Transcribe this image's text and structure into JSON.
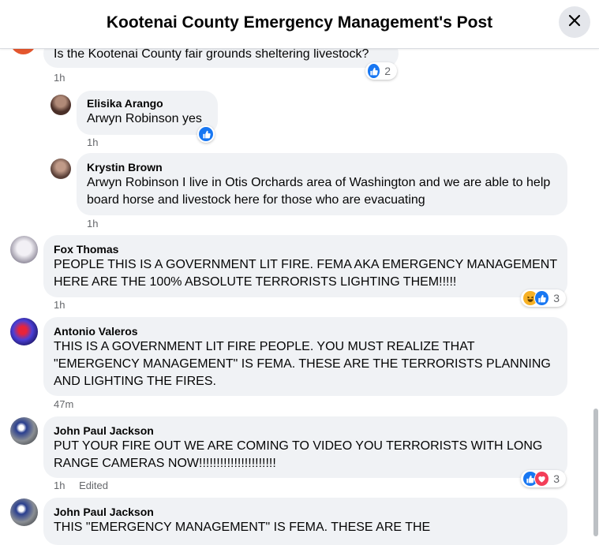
{
  "header": {
    "title": "Kootenai County Emergency Management's Post"
  },
  "comments": [
    {
      "text": "Is the Kootenai County fair grounds sheltering livestock?",
      "time": "1h",
      "reactions": {
        "types": [
          "like"
        ],
        "count": "2"
      }
    },
    {
      "author": "Elisika Arango",
      "text": "Arwyn Robinson yes",
      "time": "1h",
      "reactions": {
        "types": [
          "like"
        ],
        "count": ""
      }
    },
    {
      "author": "Krystin Brown",
      "text": "Arwyn Robinson I live in Otis Orchards area of Washington and we are able to help board horse and livestock here for those who are evacuating",
      "time": "1h"
    },
    {
      "author": "Fox Thomas",
      "text": "PEOPLE THIS IS A GOVERNMENT LIT FIRE. FEMA AKA EMERGENCY MANAGEMENT HERE ARE THE 100% ABSOLUTE TERRORISTS LIGHTING THEM!!!!!",
      "time": "1h",
      "reactions": {
        "types": [
          "haha",
          "like"
        ],
        "count": "3"
      }
    },
    {
      "author": "Antonio Valeros",
      "text": "THIS IS A GOVERNMENT LIT FIRE PEOPLE. YOU MUST REALIZE THAT \"EMERGENCY MANAGEMENT\" IS FEMA. THESE ARE THE TERRORISTS PLANNING AND LIGHTING THE FIRES.",
      "time": "47m"
    },
    {
      "author": "John Paul Jackson",
      "text": "PUT YOUR FIRE OUT WE ARE COMING TO VIDEO YOU TERRORISTS WITH LONG RANGE CAMERAS NOW!!!!!!!!!!!!!!!!!!!!!!",
      "time": "1h",
      "edited": "Edited",
      "reactions": {
        "types": [
          "like",
          "love"
        ],
        "count": "3"
      }
    },
    {
      "author": "John Paul Jackson",
      "text": "THIS \"EMERGENCY MANAGEMENT\" IS FEMA. THESE ARE THE"
    }
  ],
  "colors": {
    "like": "#1877f2",
    "haha": "#f7b125",
    "love": "#f33e58",
    "bubble": "#f0f2f5"
  }
}
